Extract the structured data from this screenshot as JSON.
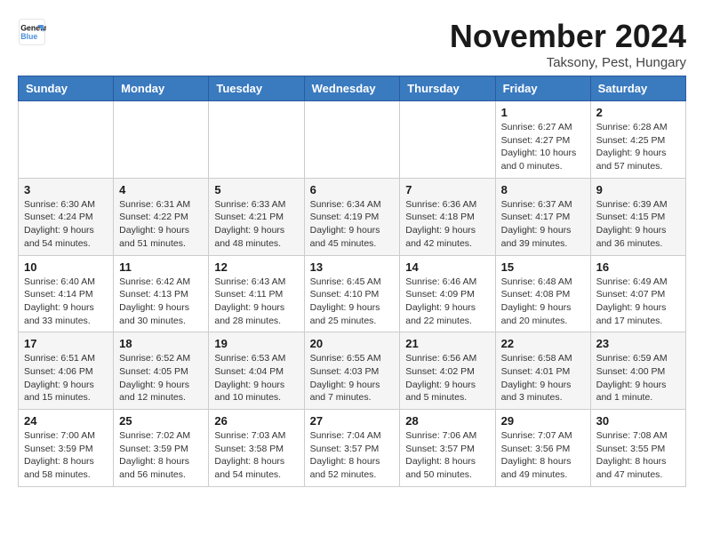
{
  "logo": {
    "line1": "General",
    "line2": "Blue"
  },
  "title": "November 2024",
  "location": "Taksony, Pest, Hungary",
  "days_of_week": [
    "Sunday",
    "Monday",
    "Tuesday",
    "Wednesday",
    "Thursday",
    "Friday",
    "Saturday"
  ],
  "weeks": [
    [
      {
        "day": "",
        "info": ""
      },
      {
        "day": "",
        "info": ""
      },
      {
        "day": "",
        "info": ""
      },
      {
        "day": "",
        "info": ""
      },
      {
        "day": "",
        "info": ""
      },
      {
        "day": "1",
        "info": "Sunrise: 6:27 AM\nSunset: 4:27 PM\nDaylight: 10 hours\nand 0 minutes."
      },
      {
        "day": "2",
        "info": "Sunrise: 6:28 AM\nSunset: 4:25 PM\nDaylight: 9 hours\nand 57 minutes."
      }
    ],
    [
      {
        "day": "3",
        "info": "Sunrise: 6:30 AM\nSunset: 4:24 PM\nDaylight: 9 hours\nand 54 minutes."
      },
      {
        "day": "4",
        "info": "Sunrise: 6:31 AM\nSunset: 4:22 PM\nDaylight: 9 hours\nand 51 minutes."
      },
      {
        "day": "5",
        "info": "Sunrise: 6:33 AM\nSunset: 4:21 PM\nDaylight: 9 hours\nand 48 minutes."
      },
      {
        "day": "6",
        "info": "Sunrise: 6:34 AM\nSunset: 4:19 PM\nDaylight: 9 hours\nand 45 minutes."
      },
      {
        "day": "7",
        "info": "Sunrise: 6:36 AM\nSunset: 4:18 PM\nDaylight: 9 hours\nand 42 minutes."
      },
      {
        "day": "8",
        "info": "Sunrise: 6:37 AM\nSunset: 4:17 PM\nDaylight: 9 hours\nand 39 minutes."
      },
      {
        "day": "9",
        "info": "Sunrise: 6:39 AM\nSunset: 4:15 PM\nDaylight: 9 hours\nand 36 minutes."
      }
    ],
    [
      {
        "day": "10",
        "info": "Sunrise: 6:40 AM\nSunset: 4:14 PM\nDaylight: 9 hours\nand 33 minutes."
      },
      {
        "day": "11",
        "info": "Sunrise: 6:42 AM\nSunset: 4:13 PM\nDaylight: 9 hours\nand 30 minutes."
      },
      {
        "day": "12",
        "info": "Sunrise: 6:43 AM\nSunset: 4:11 PM\nDaylight: 9 hours\nand 28 minutes."
      },
      {
        "day": "13",
        "info": "Sunrise: 6:45 AM\nSunset: 4:10 PM\nDaylight: 9 hours\nand 25 minutes."
      },
      {
        "day": "14",
        "info": "Sunrise: 6:46 AM\nSunset: 4:09 PM\nDaylight: 9 hours\nand 22 minutes."
      },
      {
        "day": "15",
        "info": "Sunrise: 6:48 AM\nSunset: 4:08 PM\nDaylight: 9 hours\nand 20 minutes."
      },
      {
        "day": "16",
        "info": "Sunrise: 6:49 AM\nSunset: 4:07 PM\nDaylight: 9 hours\nand 17 minutes."
      }
    ],
    [
      {
        "day": "17",
        "info": "Sunrise: 6:51 AM\nSunset: 4:06 PM\nDaylight: 9 hours\nand 15 minutes."
      },
      {
        "day": "18",
        "info": "Sunrise: 6:52 AM\nSunset: 4:05 PM\nDaylight: 9 hours\nand 12 minutes."
      },
      {
        "day": "19",
        "info": "Sunrise: 6:53 AM\nSunset: 4:04 PM\nDaylight: 9 hours\nand 10 minutes."
      },
      {
        "day": "20",
        "info": "Sunrise: 6:55 AM\nSunset: 4:03 PM\nDaylight: 9 hours\nand 7 minutes."
      },
      {
        "day": "21",
        "info": "Sunrise: 6:56 AM\nSunset: 4:02 PM\nDaylight: 9 hours\nand 5 minutes."
      },
      {
        "day": "22",
        "info": "Sunrise: 6:58 AM\nSunset: 4:01 PM\nDaylight: 9 hours\nand 3 minutes."
      },
      {
        "day": "23",
        "info": "Sunrise: 6:59 AM\nSunset: 4:00 PM\nDaylight: 9 hours\nand 1 minute."
      }
    ],
    [
      {
        "day": "24",
        "info": "Sunrise: 7:00 AM\nSunset: 3:59 PM\nDaylight: 8 hours\nand 58 minutes."
      },
      {
        "day": "25",
        "info": "Sunrise: 7:02 AM\nSunset: 3:59 PM\nDaylight: 8 hours\nand 56 minutes."
      },
      {
        "day": "26",
        "info": "Sunrise: 7:03 AM\nSunset: 3:58 PM\nDaylight: 8 hours\nand 54 minutes."
      },
      {
        "day": "27",
        "info": "Sunrise: 7:04 AM\nSunset: 3:57 PM\nDaylight: 8 hours\nand 52 minutes."
      },
      {
        "day": "28",
        "info": "Sunrise: 7:06 AM\nSunset: 3:57 PM\nDaylight: 8 hours\nand 50 minutes."
      },
      {
        "day": "29",
        "info": "Sunrise: 7:07 AM\nSunset: 3:56 PM\nDaylight: 8 hours\nand 49 minutes."
      },
      {
        "day": "30",
        "info": "Sunrise: 7:08 AM\nSunset: 3:55 PM\nDaylight: 8 hours\nand 47 minutes."
      }
    ]
  ]
}
